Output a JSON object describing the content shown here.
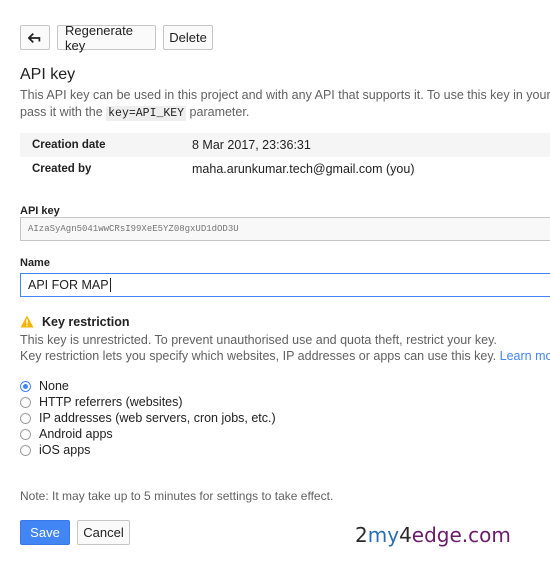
{
  "toolbar": {
    "back_icon": "arrow-left-icon",
    "regenerate_label": "Regenerate key",
    "delete_label": "Delete"
  },
  "header": {
    "title": "API key",
    "desc_line1": "This API key can be used in this project and with any API that supports it. To use this key in your ap",
    "desc_line2_pre": "pass it with the ",
    "desc_code": "key=API_KEY",
    "desc_line2_post": " parameter."
  },
  "info": [
    {
      "label": "Creation date",
      "value": "8 Mar 2017, 23:36:31"
    },
    {
      "label": "Created by",
      "value": "maha.arunkumar.tech@gmail.com (you)"
    }
  ],
  "api_key": {
    "label": "API key",
    "value": "AIzaSyAgn5041wwCRsI99XeE5YZ08gxUD1dOD3U"
  },
  "name_field": {
    "label": "Name",
    "value": "API FOR MAP"
  },
  "restriction": {
    "icon": "warning-icon",
    "title": "Key restriction",
    "line1": "This key is unrestricted. To prevent unauthorised use and quota theft, restrict your key.",
    "line2": "Key restriction lets you specify which websites, IP addresses or apps can use this key. ",
    "learn_more": "Learn more",
    "options": [
      {
        "label": "None",
        "checked": true
      },
      {
        "label": "HTTP referrers (websites)",
        "checked": false
      },
      {
        "label": "IP addresses (web servers, cron jobs, etc.)",
        "checked": false
      },
      {
        "label": "Android apps",
        "checked": false
      },
      {
        "label": "iOS apps",
        "checked": false
      }
    ]
  },
  "note": "Note: It may take up to 5 minutes for settings to take effect.",
  "actions": {
    "save_label": "Save",
    "cancel_label": "Cancel"
  },
  "watermark": {
    "part1": "2",
    "part2": "my",
    "part3": "4",
    "part4": "edge.com",
    "color1": "#2b2b2b",
    "color2": "#2a6db5",
    "color3": "#2b2b2b",
    "color4": "#6a1b6a"
  }
}
